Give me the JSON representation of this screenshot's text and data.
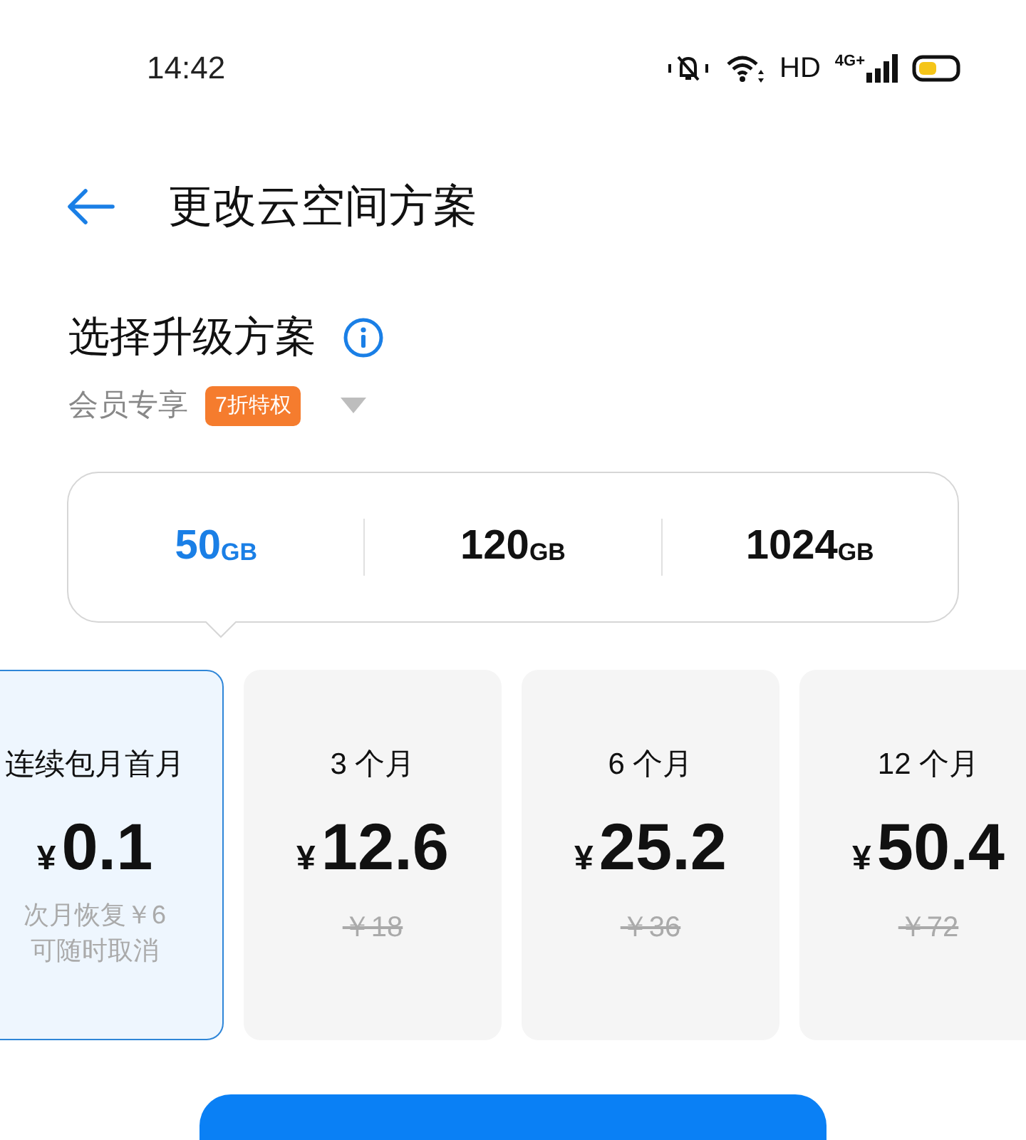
{
  "status_bar": {
    "time": "14:42",
    "network_labels": [
      "HD",
      "4G+"
    ]
  },
  "header": {
    "title": "更改云空间方案"
  },
  "section": {
    "title": "选择升级方案",
    "subtitle": "会员专享",
    "badge": "7折特权"
  },
  "capacities": [
    {
      "value": "50",
      "unit": "GB",
      "selected": true
    },
    {
      "value": "120",
      "unit": "GB",
      "selected": false
    },
    {
      "value": "1024",
      "unit": "GB",
      "selected": false
    }
  ],
  "plans": [
    {
      "kind": "intro",
      "selected": true,
      "period": "连续包月首月",
      "currency": "¥",
      "price": "0.1",
      "notes": [
        "次月恢复￥6",
        "可随时取消"
      ]
    },
    {
      "kind": "discount",
      "selected": false,
      "period": "3 个月",
      "currency": "¥",
      "price": "12.6",
      "original_price": "￥18"
    },
    {
      "kind": "discount",
      "selected": false,
      "period": "6 个月",
      "currency": "¥",
      "price": "25.2",
      "original_price": "￥36"
    },
    {
      "kind": "discount",
      "selected": false,
      "period": "12 个月",
      "currency": "¥",
      "price": "50.4",
      "original_price": "￥72"
    }
  ]
}
